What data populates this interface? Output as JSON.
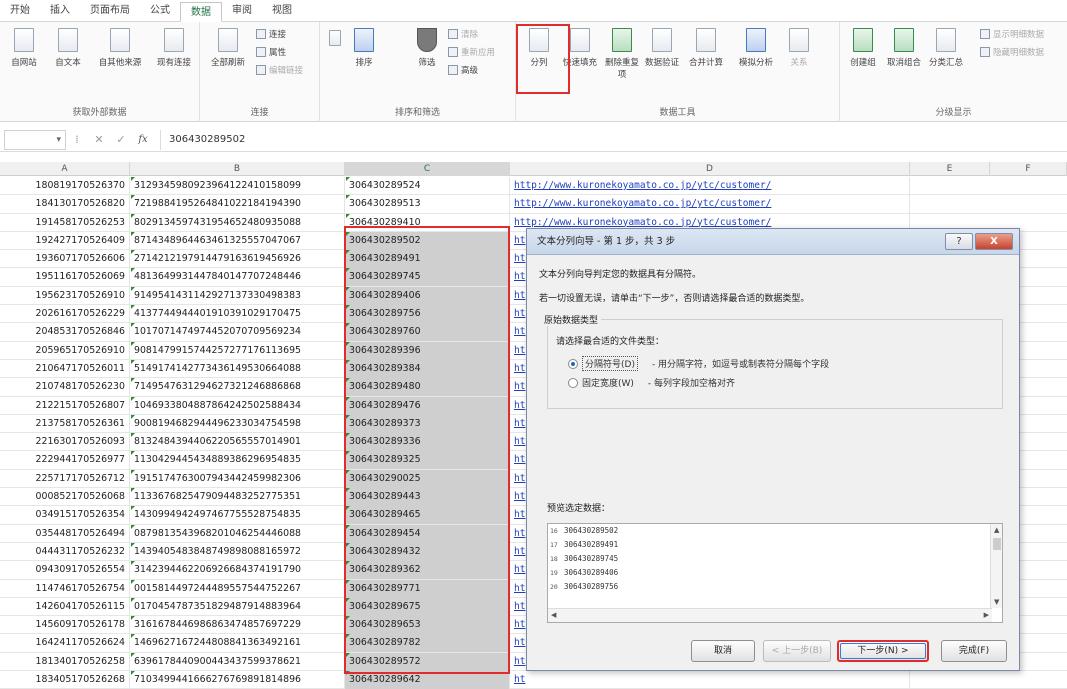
{
  "tabs": [
    "开始",
    "插入",
    "页面布局",
    "公式",
    "数据",
    "审阅",
    "视图"
  ],
  "active_tab": "数据",
  "ribbon": {
    "get_external": {
      "label": "获取外部数据",
      "buttons": [
        "自网站",
        "自文本",
        "自其他来源",
        "现有连接"
      ]
    },
    "connections": {
      "label": "连接",
      "refresh": "全部刷新",
      "small": [
        "连接",
        "属性",
        "编辑链接"
      ]
    },
    "sort_filter": {
      "label": "排序和筛选",
      "sort": "排序",
      "filter": "筛选",
      "small": [
        "清除",
        "重新应用",
        "高级"
      ]
    },
    "data_tools": {
      "label": "数据工具",
      "buttons": [
        "分列",
        "快速填充",
        "删除重复项",
        "数据验证",
        "合并计算",
        "模拟分析",
        "关系"
      ]
    },
    "outline": {
      "label": "分级显示",
      "buttons": [
        "创建组",
        "取消组合",
        "分类汇总"
      ],
      "small": [
        "显示明细数据",
        "隐藏明细数据"
      ]
    }
  },
  "formula_bar": {
    "namebox": "",
    "formula": "306430289502"
  },
  "columns": [
    "A",
    "B",
    "C",
    "D",
    "E",
    "F"
  ],
  "rows": [
    {
      "a": "180819170526370",
      "b": "3129345980923964122410158099",
      "c": "306430289524",
      "d": "http://www.kuronekoyamato.co.jp/ytc/customer/"
    },
    {
      "a": "184130170526820",
      "b": "7219884195264841022184194390",
      "c": "306430289513",
      "d": "http://www.kuronekoyamato.co.jp/ytc/customer/"
    },
    {
      "a": "191458170526253",
      "b": "8029134597431954652480935088",
      "c": "306430289410",
      "d": "http://www.kuronekoyamato.co.jp/ytc/customer/"
    },
    {
      "a": "192427170526409",
      "b": "8714348964463461325557047067",
      "c": "306430289502",
      "d": "ht"
    },
    {
      "a": "193607170526606",
      "b": "2714212197914479163619456926",
      "c": "306430289491",
      "d": "ht"
    },
    {
      "a": "195116170526069",
      "b": "4813649931447840147707248446",
      "c": "306430289745",
      "d": "ht"
    },
    {
      "a": "195623170526910",
      "b": "9149541431142927137330498383",
      "c": "306430289406",
      "d": "ht"
    },
    {
      "a": "202616170526229",
      "b": "4137744944401910391029170475",
      "c": "306430289756",
      "d": "ht"
    },
    {
      "a": "204853170526846",
      "b": "1017071474974452070709569234",
      "c": "306430289760",
      "d": "ht"
    },
    {
      "a": "205965170526910",
      "b": "9081479915744257277176113695",
      "c": "306430289396",
      "d": "ht"
    },
    {
      "a": "210647170526011",
      "b": "5149174142773436149530664088",
      "c": "306430289384",
      "d": "ht"
    },
    {
      "a": "210748170526230",
      "b": "7149547631294627321246886868",
      "c": "306430289480",
      "d": "ht"
    },
    {
      "a": "212215170526807",
      "b": "1046933804887864242502588434",
      "c": "306430289476",
      "d": "ht"
    },
    {
      "a": "213758170526361",
      "b": "9008194682944496233034754598",
      "c": "306430289373",
      "d": "ht"
    },
    {
      "a": "221630170526093",
      "b": "8132484394406220565557014901",
      "c": "306430289336",
      "d": "ht"
    },
    {
      "a": "222944170526977",
      "b": "1130429445434889386296954835",
      "c": "306430289325",
      "d": "ht"
    },
    {
      "a": "225717170526712",
      "b": "1915174763007943442459982306",
      "c": "306430290025",
      "d": "ht"
    },
    {
      "a": "000852170526068",
      "b": "1133676825479094483252775351",
      "c": "306430289443",
      "d": "ht"
    },
    {
      "a": "034915170526354",
      "b": "1430994942497467755528754835",
      "c": "306430289465",
      "d": "ht"
    },
    {
      "a": "035448170526494",
      "b": "0879813543968201046254446088",
      "c": "306430289454",
      "d": "ht"
    },
    {
      "a": "044431170526232",
      "b": "1439405483848749898088165972",
      "c": "306430289432",
      "d": "ht"
    },
    {
      "a": "094309170526554",
      "b": "3142394462206926684374191790",
      "c": "306430289362",
      "d": "ht"
    },
    {
      "a": "114746170526754",
      "b": "0015814497244489557544752267",
      "c": "306430289771",
      "d": "ht"
    },
    {
      "a": "142604170526115",
      "b": "0170454787351829487914883964",
      "c": "306430289675",
      "d": "ht"
    },
    {
      "a": "145609170526178",
      "b": "3161678446986863474857697229",
      "c": "306430289653",
      "d": "ht"
    },
    {
      "a": "164241170526624",
      "b": "1469627167244808841363492161",
      "c": "306430289782",
      "d": "ht"
    },
    {
      "a": "181340170526258",
      "b": "6396178440900443437599378621",
      "c": "306430289572",
      "d": "ht"
    },
    {
      "a": "183405170526268",
      "b": "7103499441666276769891814896",
      "c": "306430289642",
      "d": "ht"
    }
  ],
  "dialog": {
    "title": "文本分列向导 - 第 1 步，共 3 步",
    "help": "?",
    "close": "X",
    "intro": "文本分列向导判定您的数据具有分隔符。",
    "instruction": "若一切设置无误，请单击“下一步”，否则请选择最合适的数据类型。",
    "orig_type": "原始数据类型",
    "choose": "请选择最合适的文件类型：",
    "opt1_label": "分隔符号(D)",
    "opt1_desc": "- 用分隔字符，如逗号或制表符分隔每个字段",
    "opt2_label": "固定宽度(W)",
    "opt2_desc": "- 每列字段加空格对齐",
    "preview_label": "预览选定数据：",
    "preview": [
      {
        "n": "16",
        "v": "306430289502"
      },
      {
        "n": "17",
        "v": "306430289491"
      },
      {
        "n": "18",
        "v": "306430289745"
      },
      {
        "n": "19",
        "v": "306430289406"
      },
      {
        "n": "20",
        "v": "306430289756"
      }
    ],
    "cancel": "取消",
    "back": "< 上一步(B)",
    "next": "下一步(N) >",
    "finish": "完成(F)"
  }
}
